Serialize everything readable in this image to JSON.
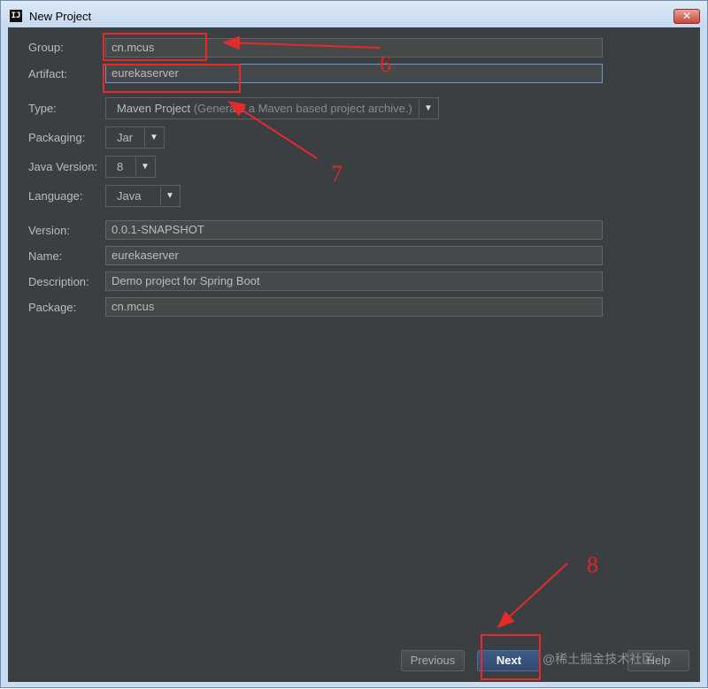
{
  "window": {
    "title": "New Project",
    "icon_text": "IJ",
    "close_symbol": "✕"
  },
  "form": {
    "group": {
      "label": "Group:",
      "value": "cn.mcus"
    },
    "artifact": {
      "label": "Artifact:",
      "value": "eurekaserver"
    },
    "type": {
      "label": "Type:",
      "value": "Maven Project",
      "hint": "(Generate a Maven based project archive.)"
    },
    "packaging": {
      "label": "Packaging:",
      "value": "Jar"
    },
    "java_version": {
      "label": "Java Version:",
      "value": "8"
    },
    "language": {
      "label": "Language:",
      "value": "Java"
    },
    "version": {
      "label": "Version:",
      "value": "0.0.1-SNAPSHOT"
    },
    "name": {
      "label": "Name:",
      "value": "eurekaserver"
    },
    "description": {
      "label": "Description:",
      "value": "Demo project for Spring Boot"
    },
    "package": {
      "label": "Package:",
      "value": "cn.mcus"
    }
  },
  "buttons": {
    "previous": "Previous",
    "next": "Next",
    "help": "Help"
  },
  "annotations": {
    "step6": "6",
    "step7": "7",
    "step8": "8"
  },
  "watermark": "@稀土掘金技术社区",
  "icons": {
    "dropdown": "▼"
  },
  "colors": {
    "annotation": "#e52a2a",
    "background": "#3c3f41",
    "accent": "#4b6ea5"
  }
}
